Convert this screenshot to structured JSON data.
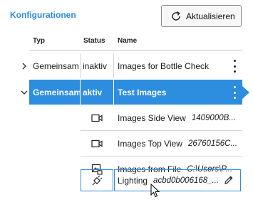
{
  "panel": {
    "title": "Konfigurationen",
    "refresh_label": "Aktualisieren"
  },
  "table": {
    "headers": {
      "typ": "Typ",
      "status": "Status",
      "name": "Name"
    },
    "rows": [
      {
        "typ": "Gemeinsam",
        "status": "inaktiv",
        "name": "Images for Bottle Check",
        "expanded": false,
        "selected": false
      },
      {
        "typ": "Gemeinsam",
        "status": "aktiv",
        "name": "Test Images",
        "expanded": true,
        "selected": true,
        "children": [
          {
            "icon": "camera-icon",
            "name": "Images Side View",
            "detail": "1409000B..."
          },
          {
            "icon": "camera-icon",
            "name": "Images Top View",
            "detail": "26760156C..."
          },
          {
            "icon": "image-file-icon",
            "name": "Images from File",
            "detail": "C:\\Users\\P..."
          },
          {
            "icon": "plug-icon",
            "name": "Lighting",
            "detail": "acbd0b006168_..."
          }
        ]
      }
    ]
  },
  "colors": {
    "accent": "#2d8ddf",
    "title": "#2a8ae0"
  }
}
